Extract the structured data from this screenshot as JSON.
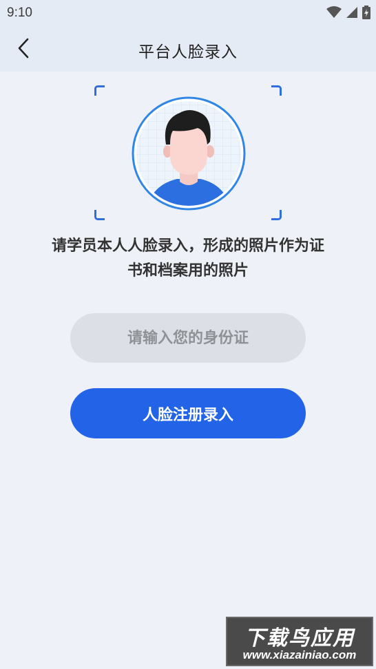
{
  "status_bar": {
    "time": "9:10",
    "icons": [
      "wifi-icon",
      "signal-icon",
      "battery-charging-icon"
    ]
  },
  "nav": {
    "title": "平台人脸录入",
    "back_icon": "chevron-left-icon"
  },
  "face_frame": {
    "avatar_icon": "face-portrait-icon",
    "accent_color": "#2f6fdc"
  },
  "instruction": {
    "line1": "请学员本人人脸录入，形成的照片作为证",
    "line2": "书和档案用的照片"
  },
  "id_input": {
    "placeholder": "请输入您的身份证",
    "value": ""
  },
  "submit": {
    "label": "人脸注册录入",
    "color": "#2363e8"
  },
  "watermark": {
    "title": "下载鸟应用",
    "url": "www.xiazainiao.com"
  }
}
